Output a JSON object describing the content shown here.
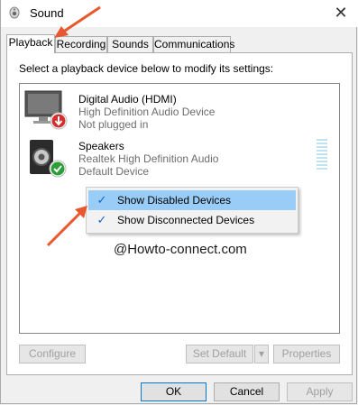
{
  "window": {
    "title": "Sound",
    "close_glyph": "✕"
  },
  "tabs": [
    {
      "label": "Playback"
    },
    {
      "label": "Recording"
    },
    {
      "label": "Sounds"
    },
    {
      "label": "Communications"
    }
  ],
  "instruction": "Select a playback device below to modify its settings:",
  "devices": [
    {
      "name": "Digital Audio (HDMI)",
      "driver": "High Definition Audio Device",
      "status": "Not plugged in",
      "icon": "monitor-icon",
      "badge": "red-down-arrow-badge"
    },
    {
      "name": "Speakers",
      "driver": "Realtek High Definition Audio",
      "status": "Default Device",
      "icon": "speaker-icon",
      "badge": "green-check-badge"
    }
  ],
  "context_menu": {
    "items": [
      {
        "label": "Show Disabled Devices",
        "checked": true,
        "check_glyph": "✓"
      },
      {
        "label": "Show Disconnected Devices",
        "checked": true,
        "check_glyph": "✓"
      }
    ]
  },
  "watermark": "@Howto-connect.com",
  "panel_buttons": {
    "configure": "Configure",
    "set_default": "Set Default",
    "set_default_arrow": "▾",
    "properties": "Properties"
  },
  "dialog_buttons": {
    "ok": "OK",
    "cancel": "Cancel",
    "apply": "Apply"
  },
  "colors": {
    "highlight": "#99ccf7",
    "annotation_arrow": "#e8572e",
    "default_button_border": "#0078d7"
  }
}
